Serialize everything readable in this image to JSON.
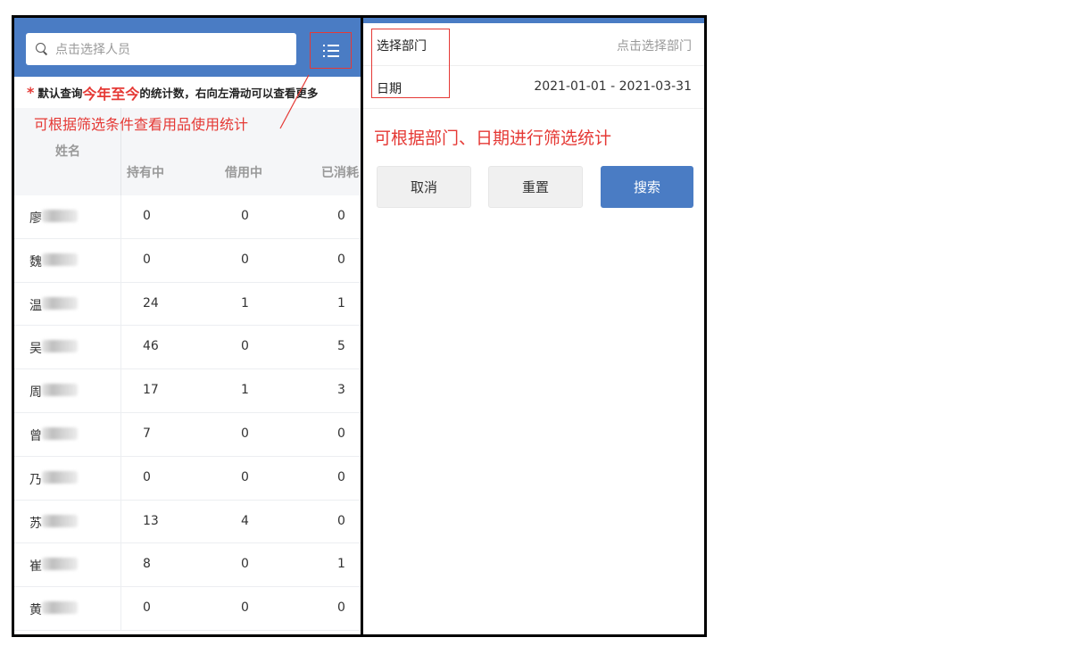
{
  "left": {
    "search_placeholder": "点击选择人员",
    "notice": {
      "star": "*",
      "prefix": "默认查询",
      "highlight": "今年至今",
      "suffix": "的统计数，右向左滑动可以查看更多"
    },
    "annotation": "可根据筛选条件查看用品使用统计",
    "columns": {
      "name": "姓名",
      "holding": "持有中",
      "borrowing": "借用中",
      "consumed": "已消耗"
    },
    "rows": [
      {
        "surname": "廖",
        "holding": "0",
        "borrowing": "0",
        "consumed": "0"
      },
      {
        "surname": "魏",
        "holding": "0",
        "borrowing": "0",
        "consumed": "0"
      },
      {
        "surname": "温",
        "holding": "24",
        "borrowing": "1",
        "consumed": "1"
      },
      {
        "surname": "吴",
        "holding": "46",
        "borrowing": "0",
        "consumed": "5"
      },
      {
        "surname": "周",
        "holding": "17",
        "borrowing": "1",
        "consumed": "3"
      },
      {
        "surname": "曾",
        "holding": "7",
        "borrowing": "0",
        "consumed": "0"
      },
      {
        "surname": "乃",
        "holding": "0",
        "borrowing": "0",
        "consumed": "0"
      },
      {
        "surname": "苏",
        "holding": "13",
        "borrowing": "4",
        "consumed": "0"
      },
      {
        "surname": "崔",
        "holding": "8",
        "borrowing": "0",
        "consumed": "1"
      },
      {
        "surname": "黄",
        "holding": "0",
        "borrowing": "0",
        "consumed": "0"
      }
    ]
  },
  "right": {
    "department": {
      "label": "选择部门",
      "placeholder": "点击选择部门"
    },
    "date": {
      "label": "日期",
      "value": "2021-01-01 - 2021-03-31"
    },
    "annotation": "可根据部门、日期进行筛选统计",
    "buttons": {
      "cancel": "取消",
      "reset": "重置",
      "search": "搜索"
    }
  },
  "colors": {
    "primary": "#4a7cc4",
    "annotation_red": "#e53935"
  }
}
